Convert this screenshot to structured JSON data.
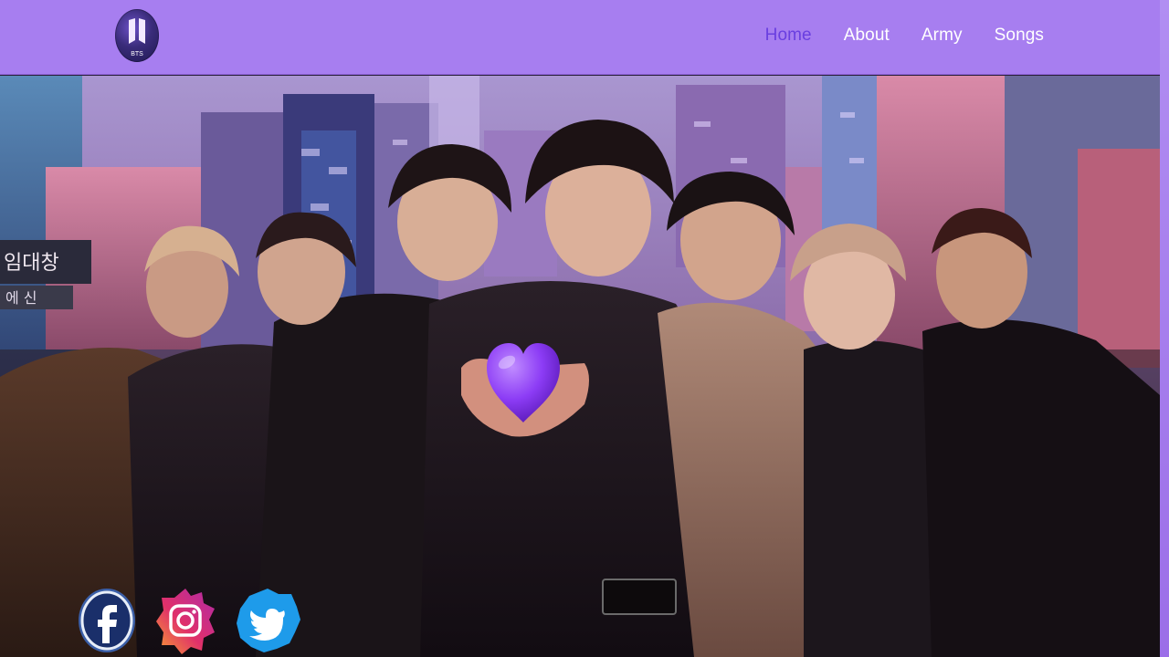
{
  "brand": {
    "logo_text": "BTS"
  },
  "nav": {
    "items": [
      {
        "label": "Home",
        "active": true
      },
      {
        "label": "About",
        "active": false
      },
      {
        "label": "Army",
        "active": false
      },
      {
        "label": "Songs",
        "active": false
      }
    ]
  },
  "hero": {
    "sign_text_1": "임대창",
    "sign_text_2": "에 신"
  },
  "socials": [
    {
      "name": "facebook",
      "icon": "facebook-icon"
    },
    {
      "name": "instagram",
      "icon": "instagram-icon"
    },
    {
      "name": "twitter",
      "icon": "twitter-icon"
    }
  ],
  "colors": {
    "navbar": "#a77ef0",
    "nav_active": "#6a3fe0",
    "nav_text": "#ffffff",
    "heart": "#8c3cf5"
  }
}
